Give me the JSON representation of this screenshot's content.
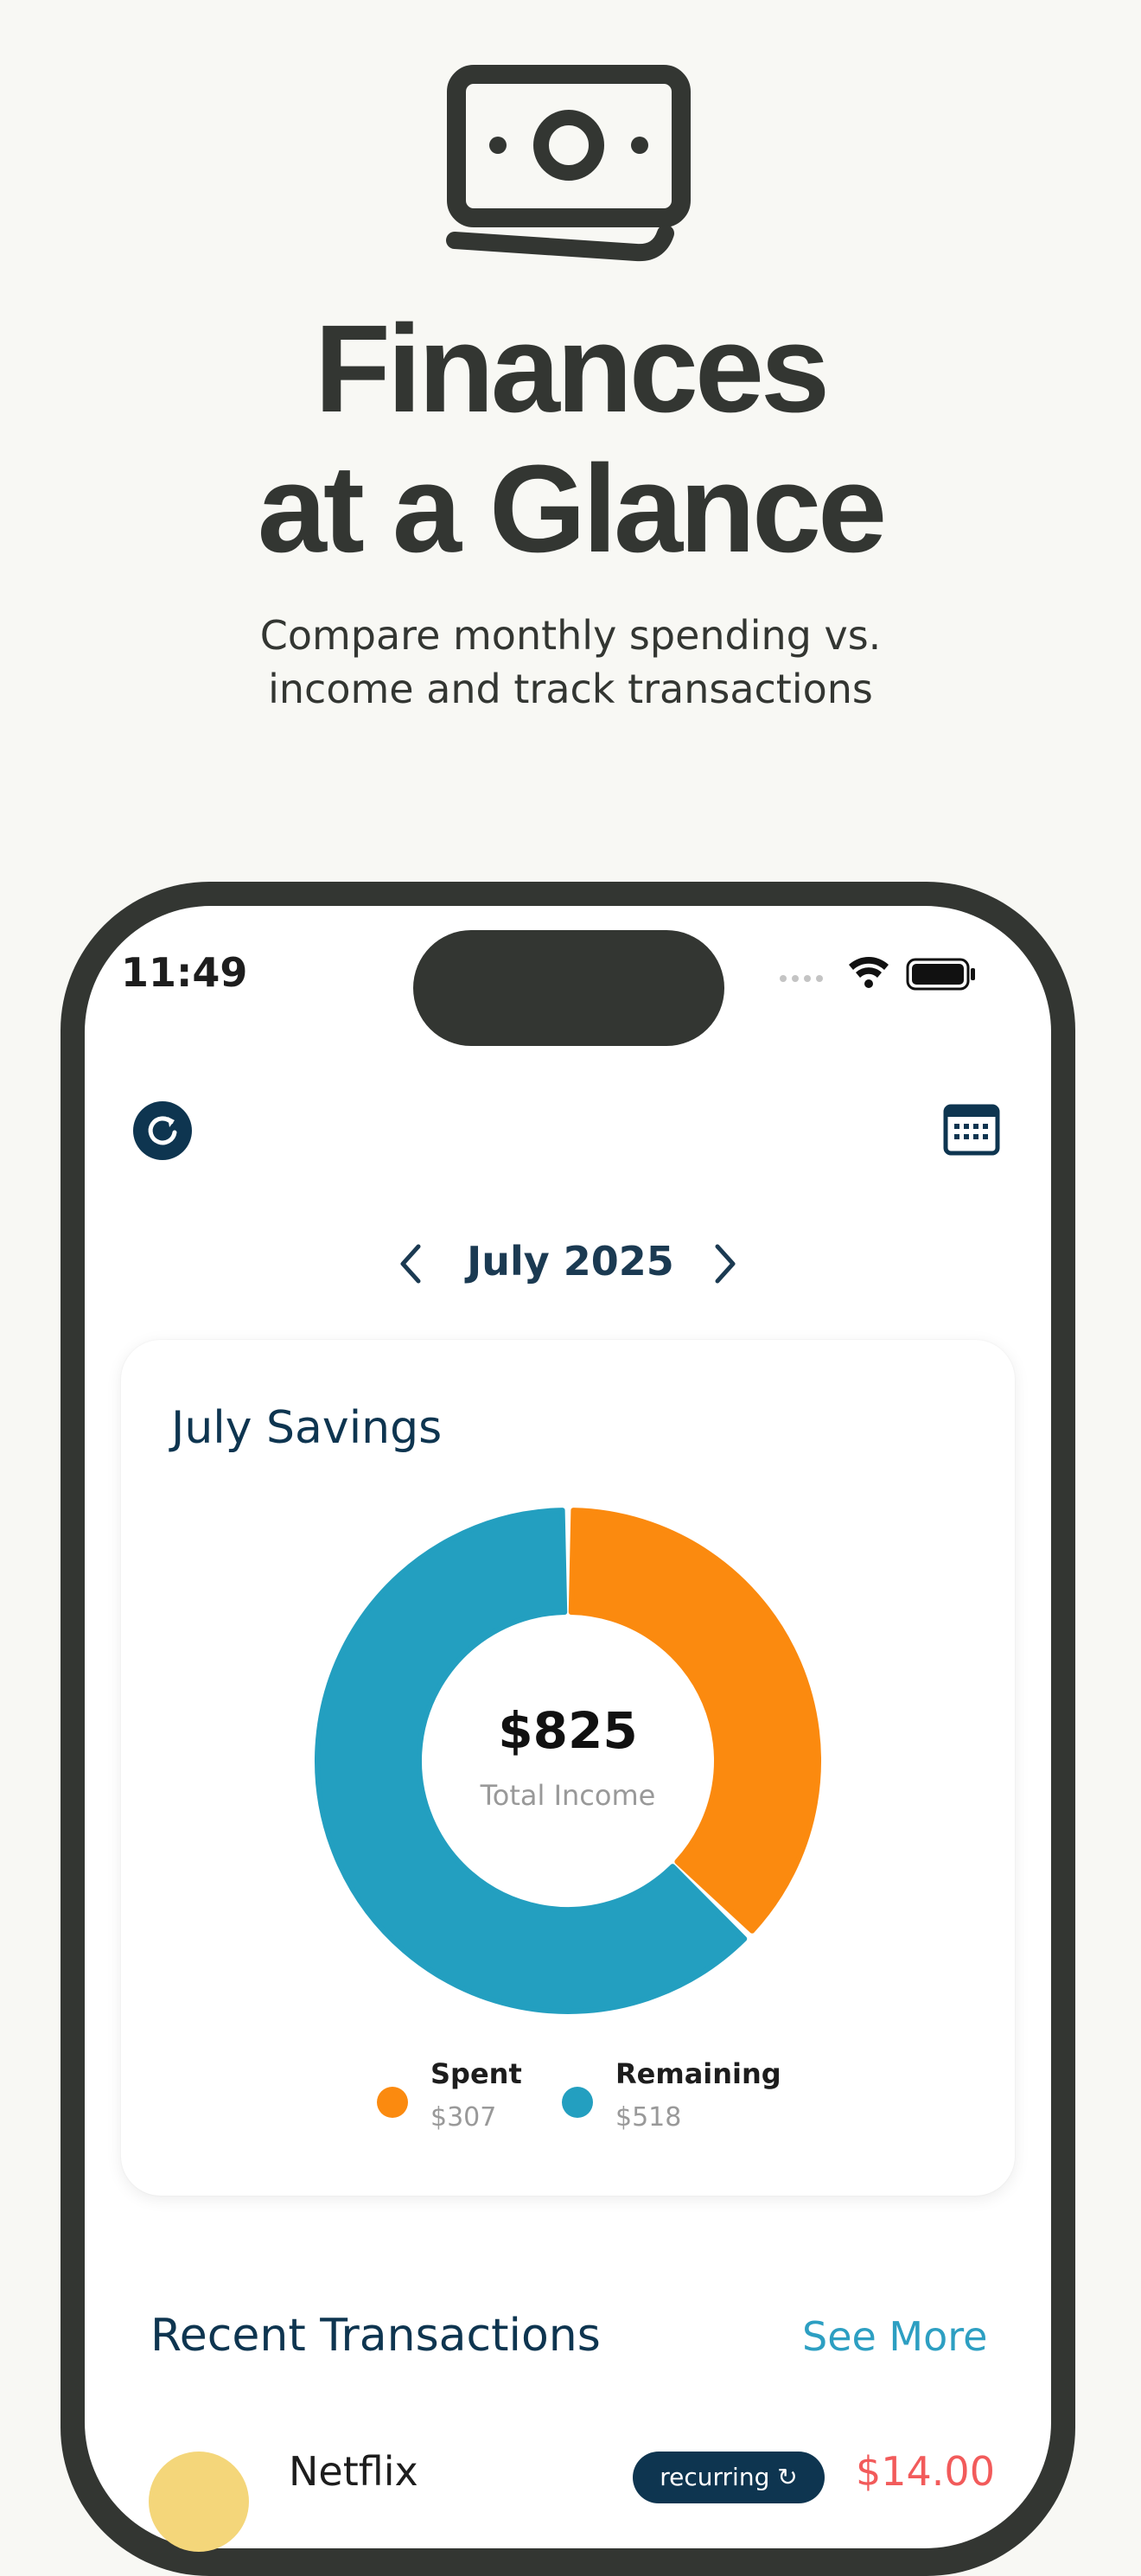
{
  "hero": {
    "icon": "cash-bill-icon",
    "headline_line1": "Finances",
    "headline_line2": "at a Glance",
    "subhead_line1": "Compare monthly spending vs.",
    "subhead_line2": "income and track transactions"
  },
  "status_bar": {
    "time": "11:49",
    "icons": [
      "signal-icon",
      "wifi-icon",
      "battery-icon"
    ]
  },
  "toolbar": {
    "refresh_icon": "refresh-icon",
    "calendar_icon": "calendar-icon"
  },
  "month_nav": {
    "label": "July 2025",
    "prev_icon": "chevron-left-icon",
    "next_icon": "chevron-right-icon"
  },
  "savings_card": {
    "title": "July Savings",
    "center_amount": "$825",
    "center_label": "Total Income",
    "legend": [
      {
        "name": "Spent",
        "value": "$307",
        "color": "#fb8a0f"
      },
      {
        "name": "Remaining",
        "value": "$518",
        "color": "#239fc0"
      }
    ]
  },
  "chart_data": {
    "type": "pie",
    "categories": [
      "Spent",
      "Remaining"
    ],
    "values": [
      307,
      518
    ],
    "colors": [
      "#fb8a0f",
      "#239fc0"
    ]
  },
  "transactions": {
    "title": "Recent Transactions",
    "see_more": "See More",
    "items": [
      {
        "name": "Netflix",
        "badge": "recurring ↻",
        "amount": "$14.00"
      }
    ]
  },
  "colors": {
    "background": "#f8f8f4",
    "frame": "#333632",
    "navy": "#0e3550",
    "accent": "#2d9fc2",
    "expense": "#f25b5b"
  }
}
